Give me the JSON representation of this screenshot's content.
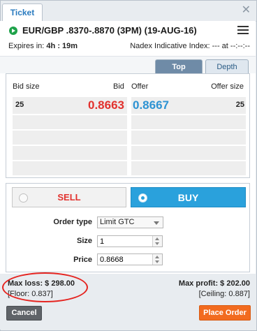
{
  "window": {
    "tab_label": "Ticket",
    "close_glyph": "✕"
  },
  "header": {
    "instrument": "EUR/GBP .8370-.8870 (3PM) (19-AUG-16)",
    "expires_label": "Expires in:",
    "expires_value": "4h : 19m",
    "indicative_label": "Nadex Indicative Index:",
    "indicative_value": "--- at --:--:--"
  },
  "tabs": {
    "top_label": "Top",
    "depth_label": "Depth"
  },
  "depth": {
    "bid_size_header": "Bid size",
    "bid_header": "Bid",
    "offer_header": "Offer",
    "offer_size_header": "Offer size",
    "rows": [
      {
        "bid_size": "25",
        "bid": "0.8663",
        "offer": "0.8667",
        "offer_size": "25"
      }
    ],
    "empty_rows": 4
  },
  "order": {
    "sell_label": "SELL",
    "buy_label": "BUY",
    "order_type_label": "Order type",
    "order_type_value": "Limit GTC",
    "size_label": "Size",
    "size_value": "1",
    "price_label": "Price",
    "price_value": "0.8668"
  },
  "footer": {
    "max_loss": "Max loss:  $ 298.00",
    "floor": "[Floor: 0.837]",
    "max_profit": "Max profit:  $ 202.00",
    "ceiling": "[Ceiling: 0.887]",
    "cancel_label": "Cancel",
    "place_label": "Place Order"
  },
  "colors": {
    "bid": "#e2322e",
    "offer": "#2d93d3",
    "buy_button": "#2aa1dc",
    "place_order": "#f26b1f",
    "annotation": "#e52521"
  }
}
